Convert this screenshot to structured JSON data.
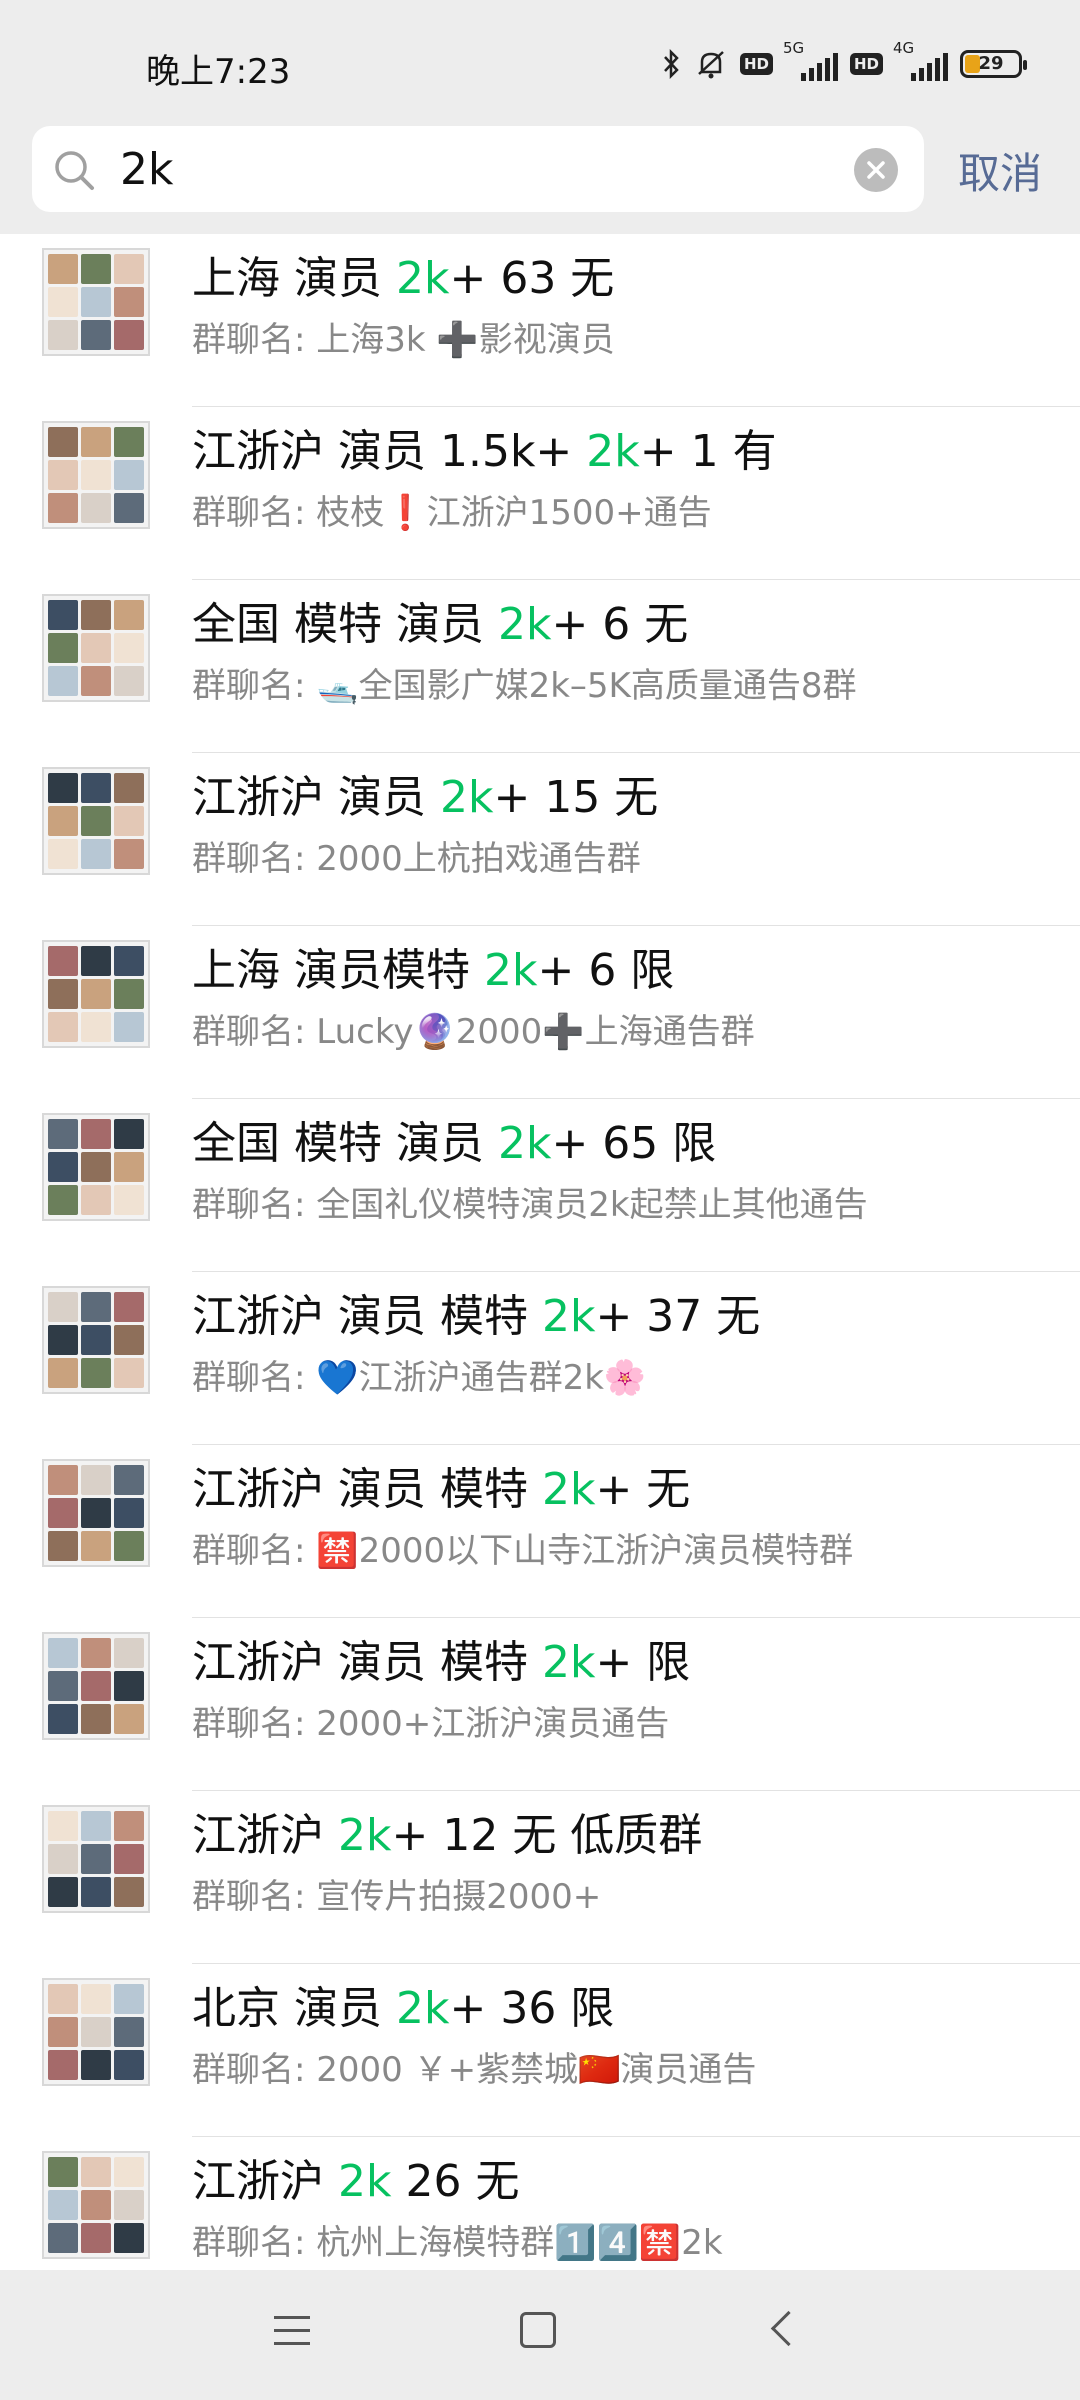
{
  "status": {
    "time": "晚上7:23",
    "net1": "5G",
    "net2": "4G",
    "battery": "29"
  },
  "search": {
    "value": "2k",
    "cancel": "取消"
  },
  "results": [
    {
      "pre": "上海 演员 ",
      "kw": "2k",
      "post": "+ 63 无",
      "sub": "群聊名: 上海3k ➕影视演员"
    },
    {
      "pre": "江浙沪 演员 1.5k+ ",
      "kw": "2k",
      "post": "+ 1 有",
      "sub": "群聊名: 枝枝❗江浙沪1500+通告"
    },
    {
      "pre": "全国 模特 演员 ",
      "kw": "2k",
      "post": "+ 6 无",
      "sub": "群聊名: 🛥️全国影广媒2k–5K高质量通告8群"
    },
    {
      "pre": "江浙沪 演员 ",
      "kw": "2k",
      "post": "+ 15 无",
      "sub": "群聊名: 2000上杭拍戏通告群"
    },
    {
      "pre": "上海 演员模特 ",
      "kw": "2k",
      "post": "+ 6 限",
      "sub": "群聊名: Lucky🔮2000➕上海通告群"
    },
    {
      "pre": "全国 模特 演员 ",
      "kw": "2k",
      "post": "+ 65 限",
      "sub": "群聊名: 全国礼仪模特演员2k起禁止其他通告"
    },
    {
      "pre": "江浙沪 演员 模特 ",
      "kw": "2k",
      "post": "+ 37 无",
      "sub": "群聊名: 💙江浙沪通告群2k🌸"
    },
    {
      "pre": "江浙沪 演员 模特 ",
      "kw": "2k",
      "post": "+ 无",
      "sub": "群聊名: 🈲2000以下山寺江浙沪演员模特群"
    },
    {
      "pre": "江浙沪 演员 模特 ",
      "kw": "2k",
      "post": "+ 限",
      "sub": "群聊名: 2000+江浙沪演员通告"
    },
    {
      "pre": "江浙沪  ",
      "kw": "2k",
      "post": "+ 12 无 低质群",
      "sub": "群聊名: 宣传片拍摄2000+"
    },
    {
      "pre": "北京 演员 ",
      "kw": "2k",
      "post": "+ 36 限",
      "sub": "群聊名: 2000 ￥+紫禁城🇨🇳演员通告"
    },
    {
      "pre": "江浙沪  ",
      "kw": "2k",
      "post": "  26 无",
      "sub": "群聊名: 杭州上海模特群1️⃣4️⃣🈲2k"
    }
  ]
}
